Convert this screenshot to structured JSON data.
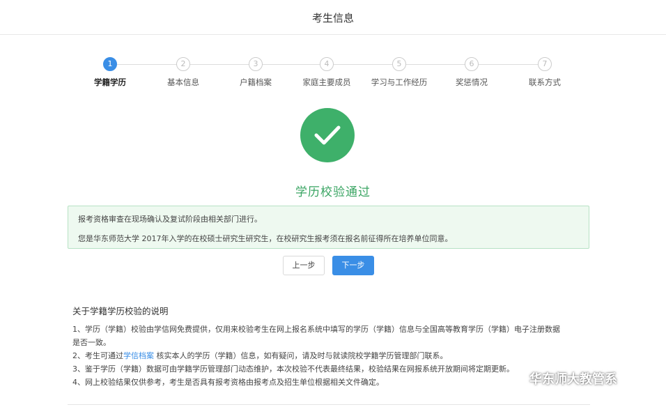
{
  "header": {
    "title": "考生信息"
  },
  "steps": [
    {
      "num": "1",
      "label": "学籍学历",
      "active": true
    },
    {
      "num": "2",
      "label": "基本信息",
      "active": false
    },
    {
      "num": "3",
      "label": "户籍档案",
      "active": false
    },
    {
      "num": "4",
      "label": "家庭主要成员",
      "active": false
    },
    {
      "num": "5",
      "label": "学习与工作经历",
      "active": false
    },
    {
      "num": "6",
      "label": "奖惩情况",
      "active": false
    },
    {
      "num": "7",
      "label": "联系方式",
      "active": false
    }
  ],
  "result": {
    "title": "学历校验通过",
    "icon": "checkmark-icon",
    "color": "#3eb06a"
  },
  "notice": {
    "line1": "报考资格审查在现场确认及复试阶段由相关部门进行。",
    "line2": "您是华东师范大学 2017年入学的在校硕士研究生研究生，在校研究生报考须在报名前征得所在培养单位同意。"
  },
  "buttons": {
    "prev": "上一步",
    "next": "下一步"
  },
  "description": {
    "title": "关于学籍学历校验的说明",
    "item1_a": "1、学历（学籍）校验由学信网免费提供，仅用来校验考生在网上报名系统中填写的学历（学籍）信息与全国高等教育学历（学籍）电子注册数据",
    "item1_b": "是否一致。",
    "item2_pre": "2、考生可通过",
    "item2_link": "学信档案",
    "item2_post": " 核实本人的学历（学籍）信息，如有疑问，请及时与就读院校学籍学历管理部门联系。",
    "item3": "3、鉴于学历（学籍）数据可由学籍学历管理部门动态维护，本次校验不代表最终结果，校验结果在网报系统开放期间将定期更新。",
    "item4": "4、网上校验结果仅供参考，考生是否具有报考资格由报考点及招生单位根据相关文件确定。"
  },
  "watermark": {
    "text": "华东师大教管系",
    "icon": "wechat-icon"
  },
  "colors": {
    "primary": "#3a8ee6",
    "success": "#3eb06a",
    "notice_bg": "#eef9f0"
  }
}
